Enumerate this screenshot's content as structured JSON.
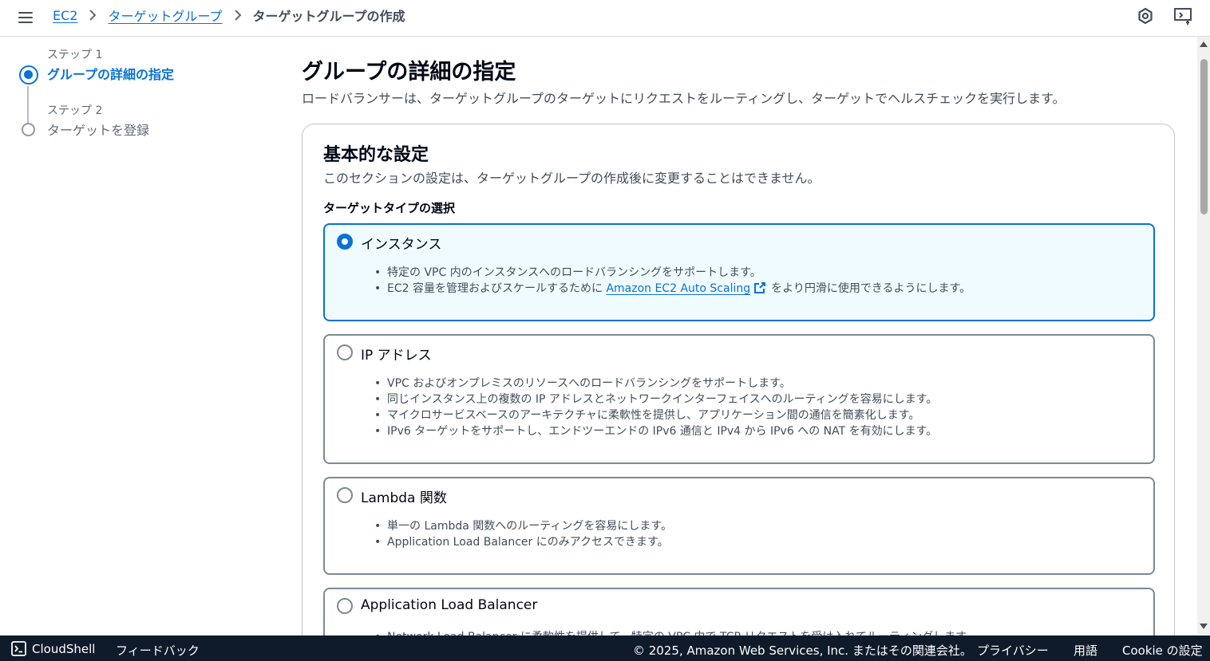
{
  "breadcrumb": {
    "items": [
      "EC2",
      "ターゲットグループ"
    ],
    "current": "ターゲットグループの作成"
  },
  "steps": [
    {
      "label": "ステップ 1",
      "title": "グループの詳細の指定",
      "active": true
    },
    {
      "label": "ステップ 2",
      "title": "ターゲットを登録",
      "active": false
    }
  ],
  "page": {
    "title": "グループの詳細の指定",
    "description": "ロードバランサーは、ターゲットグループのターゲットにリクエストをルーティングし、ターゲットでヘルスチェックを実行します。"
  },
  "section": {
    "title": "基本的な設定",
    "description": "このセクションの設定は、ターゲットグループの作成後に変更することはできません。",
    "target_type_label": "ターゲットタイプの選択"
  },
  "target_types": [
    {
      "title": "インスタンス",
      "selected": true,
      "bullets": [
        "特定の VPC 内のインスタンスへのロードバランシングをサポートします。"
      ],
      "bullet2_prefix": "EC2 容量を管理およびスケールするために ",
      "bullet2_link": "Amazon EC2 Auto Scaling",
      "bullet2_suffix": "をより円滑に使用できるようにします。"
    },
    {
      "title": "IP アドレス",
      "selected": false,
      "bullets": [
        "VPC およびオンプレミスのリソースへのロードバランシングをサポートします。",
        "同じインスタンス上の複数の IP アドレスとネットワークインターフェイスへのルーティングを容易にします。",
        "マイクロサービスベースのアーキテクチャに柔軟性を提供し、アプリケーション間の通信を簡素化します。",
        "IPv6 ターゲットをサポートし、エンドツーエンドの IPv6 通信と IPv4 から IPv6 への NAT を有効にします。"
      ]
    },
    {
      "title": "Lambda 関数",
      "selected": false,
      "bullets": [
        "単一の Lambda 関数へのルーティングを容易にします。",
        "Application Load Balancer にのみアクセスできます。"
      ]
    },
    {
      "title": "Application Load Balancer",
      "selected": false,
      "bullets": [
        "Network Load Balancer に柔軟性を提供して、特定の VPC 内で TCP リクエストを受け入れてルーティングします。"
      ]
    }
  ],
  "footer": {
    "cloudshell": "CloudShell",
    "feedback": "フィードバック",
    "copyright": "© 2025, Amazon Web Services, Inc. またはその関連会社。",
    "privacy": "プライバシー",
    "terms": "用語",
    "cookie": "Cookie の設定"
  },
  "colors": {
    "accent": "#0972d3",
    "footer_bg": "#0f1b2a",
    "selected_tile_bg": "#f0fbff"
  }
}
